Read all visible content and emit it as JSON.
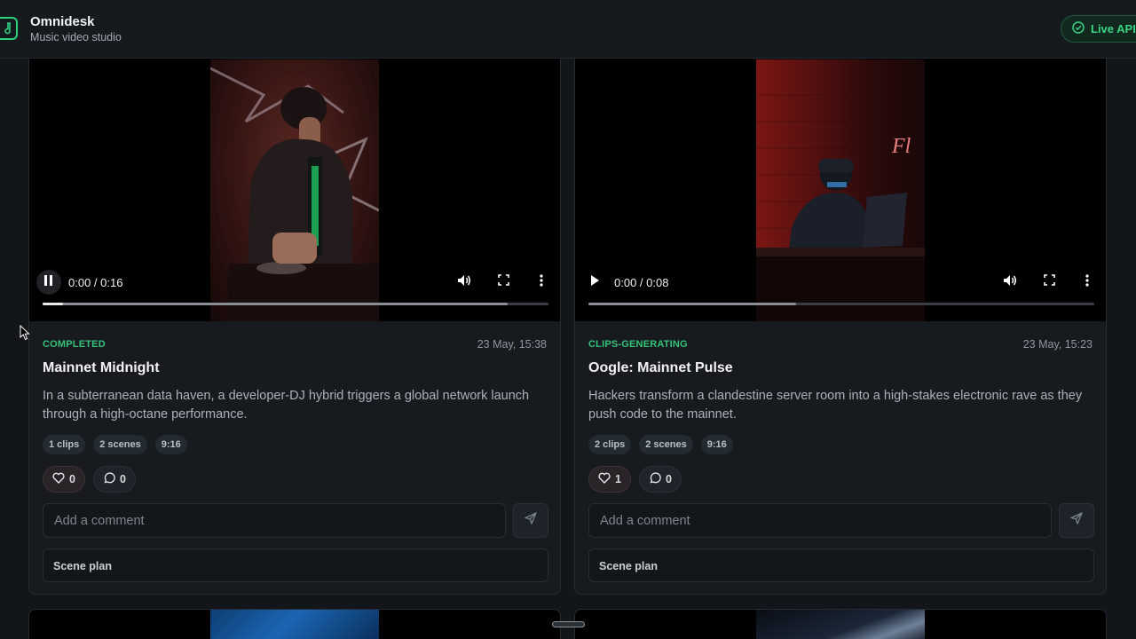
{
  "header": {
    "title": "Omnidesk",
    "subtitle": "Music video studio",
    "live_label": "Live API"
  },
  "colors": {
    "accent": "#35c378",
    "background": "#121519",
    "card": "#171b20"
  },
  "cards": [
    {
      "status": "COMPLETED",
      "date": "23 May, 15:38",
      "title": "Mainnet Midnight",
      "description": "In a subterranean data haven, a developer-DJ hybrid triggers a global network launch through a high-octane performance.",
      "tags": [
        "1 clips",
        "2 scenes",
        "9:16"
      ],
      "likes": "0",
      "comments": "0",
      "comment_placeholder": "Add a comment",
      "scene_plan_label": "Scene plan",
      "video": {
        "time": "0:00 / 0:16",
        "state": "playing",
        "buffered": 0.92,
        "played": 0.04
      }
    },
    {
      "status": "CLIPS-GENERATING",
      "date": "23 May, 15:23",
      "title": "Oogle: Mainnet Pulse",
      "description": "Hackers transform a clandestine server room into a high-stakes electronic rave as they push code to the mainnet.",
      "tags": [
        "2 clips",
        "2 scenes",
        "9:16"
      ],
      "likes": "1",
      "comments": "0",
      "comment_placeholder": "Add a comment",
      "scene_plan_label": "Scene plan",
      "video": {
        "time": "0:00 / 0:08",
        "state": "paused",
        "buffered": 0.41,
        "played": 0.0
      }
    }
  ]
}
